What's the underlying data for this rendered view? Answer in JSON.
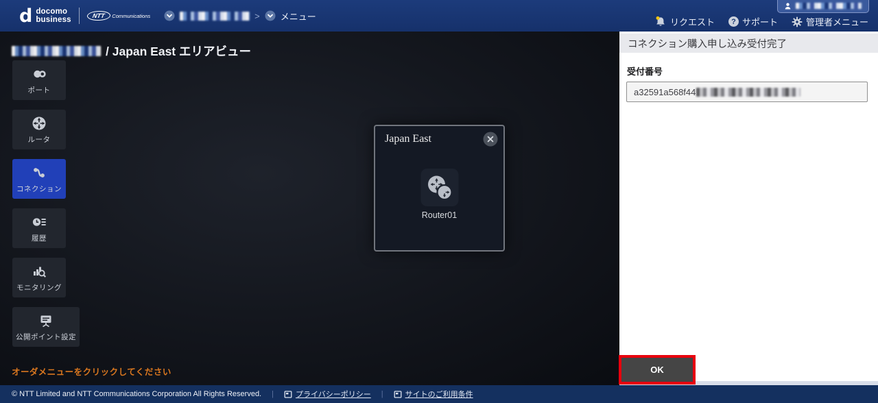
{
  "colors": {
    "navbar": "#19366f",
    "footer": "#14305f",
    "sidebar_selected": "#2140b8",
    "highlight_red": "#e8000d",
    "hint_orange": "#d9771f",
    "panel_band": "#e8e9ed",
    "ok_button": "#454545"
  },
  "navbar": {
    "logo_d": "d",
    "logo_line1": "docomo",
    "logo_line2": "business",
    "logo_ntt": "NTT",
    "logo_ntt_sub": "Communications",
    "breadcrumb_separator": ">",
    "menu_label": "メニュー",
    "request_label": "リクエスト",
    "support_label": "サポート",
    "support_icon_glyph": "?",
    "admin_menu_label": "管理者メニュー"
  },
  "page": {
    "title_suffix": "/ Japan East エリアビュー",
    "hint": "オーダメニューをクリックしてください"
  },
  "sidebar": {
    "items": [
      {
        "label": "ポート",
        "icon": "port-icon",
        "selected": false
      },
      {
        "label": "ルータ",
        "icon": "router-icon",
        "selected": false
      },
      {
        "label": "コネクション",
        "icon": "connection-icon",
        "selected": true
      },
      {
        "label": "履歴",
        "icon": "history-icon",
        "selected": false
      },
      {
        "label": "モニタリング",
        "icon": "monitoring-icon",
        "selected": false
      },
      {
        "label": "公開ポイント設定",
        "icon": "public-point-icon",
        "selected": false
      }
    ]
  },
  "area_view": {
    "title": "Japan East",
    "node_label": "Router01",
    "node_icon": "router-node-icon"
  },
  "result_panel": {
    "title": "コネクション購入申し込み受付完了",
    "receipt_label": "受付番号",
    "receipt_value_visible": "a32591a568f44",
    "ok_label": "OK"
  },
  "footer": {
    "copyright": "© NTT Limited and NTT Communications Corporation All Rights Reserved.",
    "divider": "|",
    "links": [
      {
        "label": "プライバシーポリシー",
        "icon": "external-link-icon"
      },
      {
        "label": "サイトのご利用条件",
        "icon": "external-link-icon"
      }
    ]
  }
}
